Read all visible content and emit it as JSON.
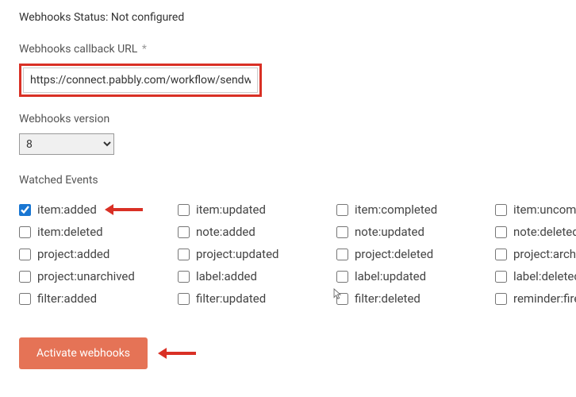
{
  "status": {
    "prefix": "Webhooks Status:",
    "value": "Not configured"
  },
  "url": {
    "label": "Webhooks callback URL",
    "asterisk": "*",
    "value": "https://connect.pabbly.com/workflow/sendw"
  },
  "version": {
    "label": "Webhooks version",
    "value": "8"
  },
  "watched_events_label": "Watched Events",
  "events": [
    {
      "label": "item:added",
      "checked": true,
      "arrow": true
    },
    {
      "label": "item:updated",
      "checked": false
    },
    {
      "label": "item:completed",
      "checked": false
    },
    {
      "label": "item:uncompleted",
      "checked": false
    },
    {
      "label": "item:deleted",
      "checked": false
    },
    {
      "label": "note:added",
      "checked": false
    },
    {
      "label": "note:updated",
      "checked": false
    },
    {
      "label": "note:deleted",
      "checked": false
    },
    {
      "label": "project:added",
      "checked": false
    },
    {
      "label": "project:updated",
      "checked": false
    },
    {
      "label": "project:deleted",
      "checked": false
    },
    {
      "label": "project:archived",
      "checked": false
    },
    {
      "label": "project:unarchived",
      "checked": false
    },
    {
      "label": "label:added",
      "checked": false
    },
    {
      "label": "label:updated",
      "checked": false
    },
    {
      "label": "label:deleted",
      "checked": false
    },
    {
      "label": "filter:added",
      "checked": false
    },
    {
      "label": "filter:updated",
      "checked": false
    },
    {
      "label": "filter:deleted",
      "checked": false
    },
    {
      "label": "reminder:fired",
      "checked": false
    }
  ],
  "activate_button": "Activate webhooks"
}
